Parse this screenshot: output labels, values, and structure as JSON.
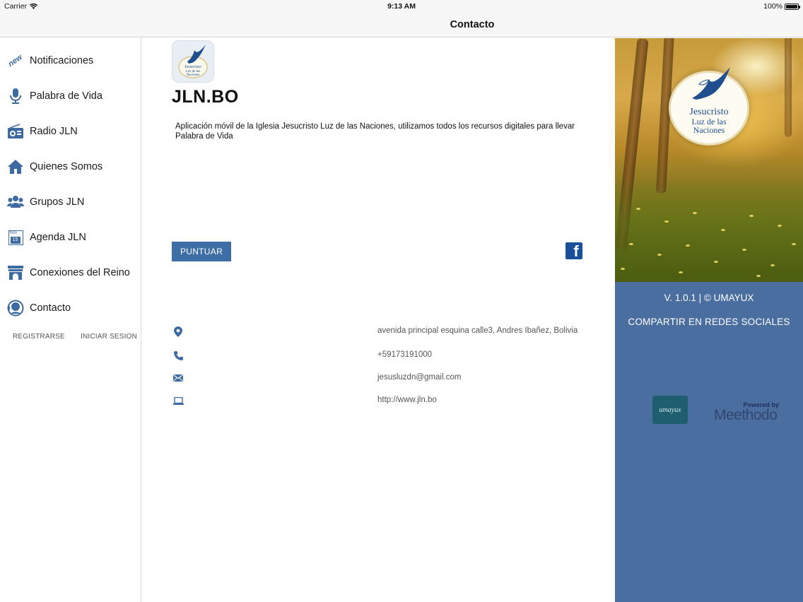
{
  "status_bar": {
    "carrier": "Carrier",
    "time": "9:13 AM",
    "battery": "100%"
  },
  "navbar": {
    "title": "Contacto"
  },
  "sidebar": {
    "items": [
      {
        "label": "Notificaciones",
        "icon": "new-badge-icon"
      },
      {
        "label": "Palabra de Vida",
        "icon": "microphone-icon"
      },
      {
        "label": "Radio JLN",
        "icon": "radio-icon"
      },
      {
        "label": "Quienes Somos",
        "icon": "home-icon"
      },
      {
        "label": "Grupos JLN",
        "icon": "group-icon"
      },
      {
        "label": "Agenda JLN",
        "icon": "calendar-icon"
      },
      {
        "label": "Conexiones del Reino",
        "icon": "arch-icon"
      },
      {
        "label": "Contacto",
        "icon": "headset-icon"
      }
    ],
    "new_badge": "new",
    "calendar_month": "Nov",
    "calendar_day": "15",
    "register_label": "REGISTRARSE",
    "login_label": "INICIAR SESION"
  },
  "main": {
    "app_name": "JLN.BO",
    "description": "Aplicación móvil de la Iglesia Jesucristo Luz de las Naciones, utilizamos todos los recursos digitales para llevar Palabra de Vida",
    "rate_button": "PUNTUAR",
    "contacts": [
      {
        "icon": "location-pin-icon",
        "value": "avenida principal esquina calle3, Andres Ibañez, Bolivia"
      },
      {
        "icon": "phone-icon",
        "value": "+59173191000"
      },
      {
        "icon": "mail-icon",
        "value": "jesusluzdn@gmail.com"
      },
      {
        "icon": "laptop-icon",
        "value": "http://www.jln.bo"
      }
    ]
  },
  "panel": {
    "emblem_line1": "Jesucristo",
    "emblem_line2": "Luz de las",
    "emblem_line3": "Naciones",
    "version": "V. 1.0.1 | © UMAYUX",
    "share": "COMPARTIR EN REDES SOCIALES",
    "umayux_logo_text": "umayux",
    "powered_by": "Powered by",
    "methodo": "Meethodo"
  },
  "colors": {
    "accent": "#3d6ea6",
    "panel_bg": "#4a6ea0",
    "facebook": "#1a4f99",
    "icon_blue": "#3e6aa2"
  }
}
